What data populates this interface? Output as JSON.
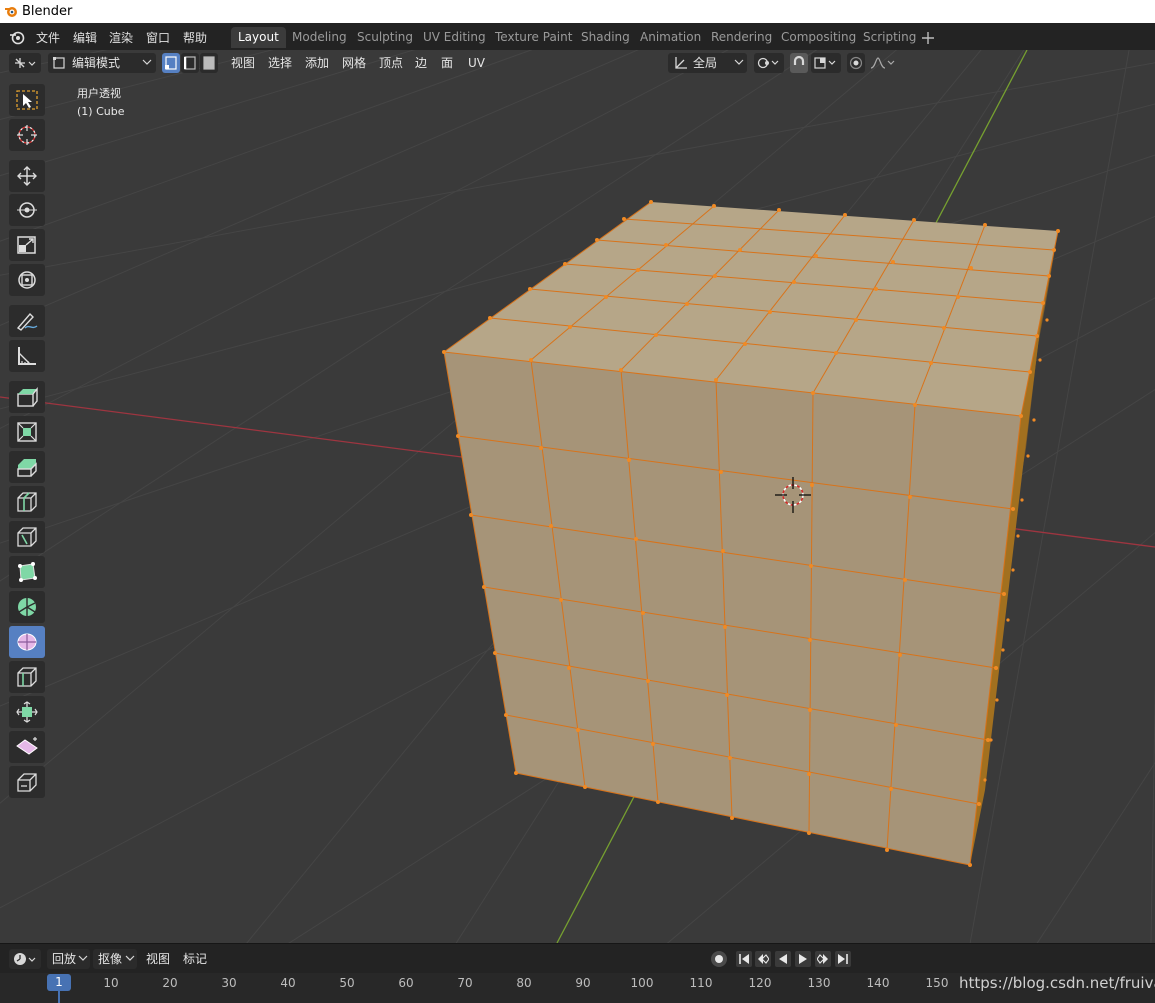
{
  "window": {
    "title": "Blender"
  },
  "menu": [
    "文件",
    "编辑",
    "渲染",
    "窗口",
    "帮助"
  ],
  "workspace_tabs": [
    "Layout",
    "Modeling",
    "Sculpting",
    "UV Editing",
    "Texture Paint",
    "Shading",
    "Animation",
    "Rendering",
    "Compositing",
    "Scripting"
  ],
  "active_workspace": "Layout",
  "view_header": {
    "mode": "编辑模式",
    "menus": [
      "视图",
      "选择",
      "添加",
      "网格",
      "顶点",
      "边",
      "面",
      "UV"
    ],
    "orientation": "全局"
  },
  "viewport": {
    "view_name": "用户透视",
    "object": "(1) Cube"
  },
  "tools": [
    "select-box",
    "cursor",
    "move",
    "rotate",
    "scale",
    "transform",
    "annotate",
    "measure",
    "extrude-region",
    "inset-faces",
    "bevel",
    "loop-cut",
    "knife",
    "poly-build",
    "spin",
    "smooth",
    "edge-slide",
    "shrink-fatten",
    "shear",
    "rip-region"
  ],
  "active_tool": "smooth",
  "timeline": {
    "menus": [
      "回放",
      "抠像",
      "视图",
      "标记"
    ],
    "current_frame": "1",
    "ticks": [
      "10",
      "20",
      "30",
      "40",
      "50",
      "60",
      "70",
      "80",
      "90",
      "100",
      "110",
      "120",
      "130",
      "140",
      "150"
    ]
  },
  "watermark": "https://blog.csdn.net/fruiva",
  "colors": {
    "background": "#3a3a3a",
    "mesh_face": "#b3a083",
    "mesh_edge": "#e07a1a",
    "active_tab": "#3b3b3b",
    "active_tool": "#5680c2",
    "x_axis": "#a33a45",
    "y_axis": "#7aa23a"
  }
}
